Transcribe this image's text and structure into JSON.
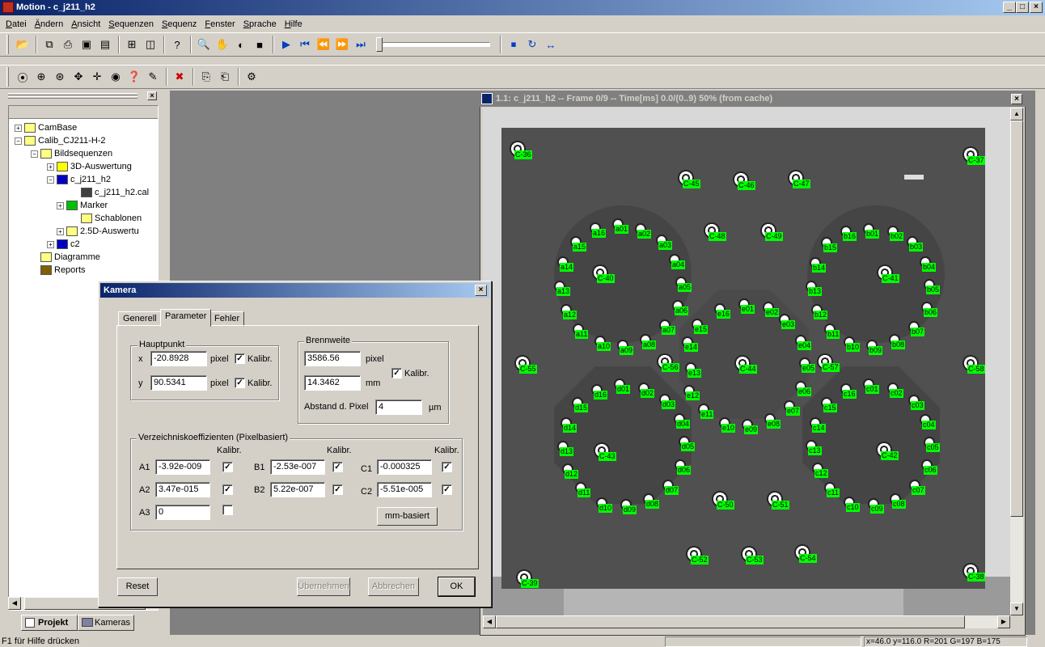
{
  "window": {
    "title": "Motion - c_j211_h2",
    "min": "_",
    "max": "□",
    "close": "×"
  },
  "menu": [
    "Datei",
    "Ändern",
    "Ansicht",
    "Sequenzen",
    "Sequenz",
    "Fenster",
    "Sprache",
    "Hilfe"
  ],
  "panel": {
    "close": "×"
  },
  "tree": [
    {
      "label": "CamBase",
      "exp": "+"
    },
    {
      "label": "Calib_CJ211-H-2",
      "exp": "−"
    },
    {
      "label": "Bildsequenzen",
      "exp": "−"
    },
    {
      "label": "3D-Auswertung",
      "exp": "+"
    },
    {
      "label": "c_j211_h2",
      "exp": "−"
    },
    {
      "label": "c_j211_h2.cal",
      "exp": ""
    },
    {
      "label": "Marker",
      "exp": "+"
    },
    {
      "label": "Schablonen",
      "exp": ""
    },
    {
      "label": "2.5D-Auswertu",
      "exp": "+"
    },
    {
      "label": "c2",
      "exp": "+"
    },
    {
      "label": "Diagramme",
      "exp": ""
    },
    {
      "label": "Reports",
      "exp": ""
    }
  ],
  "bottom_tabs": {
    "project": "Projekt",
    "cameras": "Kameras"
  },
  "image_window": {
    "title": "1.1: c_j211_h2 -- Frame 0/9 -- Time[ms] 0.0/(0..9) 50% (from cache)",
    "close": "×"
  },
  "markers": {
    "big": [
      "C-36",
      "C-37",
      "C-45",
      "C-46",
      "C-47",
      "C-48",
      "C-49",
      "C-40",
      "C-41",
      "C-44",
      "C-55",
      "C-56",
      "C-57",
      "C-58",
      "C-43",
      "C-42",
      "C-50",
      "C-51",
      "C-52",
      "C-53",
      "C-54",
      "C-39",
      "C-38"
    ],
    "a": [
      "a01",
      "a02",
      "a03",
      "a04",
      "a05",
      "a06",
      "a07",
      "a08",
      "a09",
      "a10",
      "a11",
      "a12",
      "a13",
      "a14",
      "a15",
      "a16"
    ],
    "b": [
      "b01",
      "b02",
      "b03",
      "b04",
      "b05",
      "b06",
      "b07",
      "b08",
      "b09",
      "b10",
      "b11",
      "b12",
      "b13",
      "b14",
      "b15",
      "b16"
    ],
    "e": [
      "e01",
      "e02",
      "e03",
      "e04",
      "e05",
      "e06",
      "e07",
      "e08",
      "e09",
      "e10",
      "e11",
      "e12",
      "e13",
      "e14",
      "e15",
      "e16"
    ],
    "d": [
      "d01",
      "d02",
      "d03",
      "d04",
      "d05",
      "d06",
      "d07",
      "d08",
      "d09",
      "d10",
      "d11",
      "d12",
      "d13",
      "d14",
      "d15",
      "d16"
    ],
    "c": [
      "c01",
      "c02",
      "c03",
      "c04",
      "c05",
      "c06",
      "c07",
      "c08",
      "c09",
      "c10",
      "c11",
      "c12",
      "c13",
      "c14",
      "c15",
      "c16"
    ]
  },
  "dialog": {
    "title": "Kamera",
    "close": "×",
    "tabs": [
      "Generell",
      "Parameter",
      "Fehler"
    ],
    "hauptpunkt": {
      "legend": "Hauptpunkt",
      "x_label": "x",
      "x_value": "-20.8928",
      "y_label": "y",
      "y_value": "90.5341",
      "unit": "pixel",
      "kalibr": "Kalibr."
    },
    "brennweite": {
      "legend": "Brennweite",
      "px_value": "3586.56",
      "px_unit": "pixel",
      "mm_value": "14.3462",
      "mm_unit": "mm",
      "kalibr": "Kalibr.",
      "abstand_label": "Abstand d. Pixel",
      "abstand_value": "4",
      "abstand_unit": "µm"
    },
    "verz": {
      "legend": "Verzeichniskoeffizienten (Pixelbasiert)",
      "kalibr": "Kalibr.",
      "A1": "-3.92e-009",
      "A2": "3.47e-015",
      "A3": "0",
      "B1": "-2.53e-007",
      "B2": "5.22e-007",
      "C1": "-0.000325",
      "C2": "-5.51e-005",
      "labels": [
        "A1",
        "A2",
        "A3",
        "B1",
        "B2",
        "C1",
        "C2"
      ],
      "mm_button": "mm-basiert"
    },
    "buttons": {
      "reset": "Reset",
      "apply": "Übernehmen",
      "cancel": "Abbrechen",
      "ok": "OK"
    }
  },
  "status": {
    "help": "F1 für Hilfe drücken",
    "coords": "x=46.0 y=116.0 R=201 G=197 B=175"
  }
}
